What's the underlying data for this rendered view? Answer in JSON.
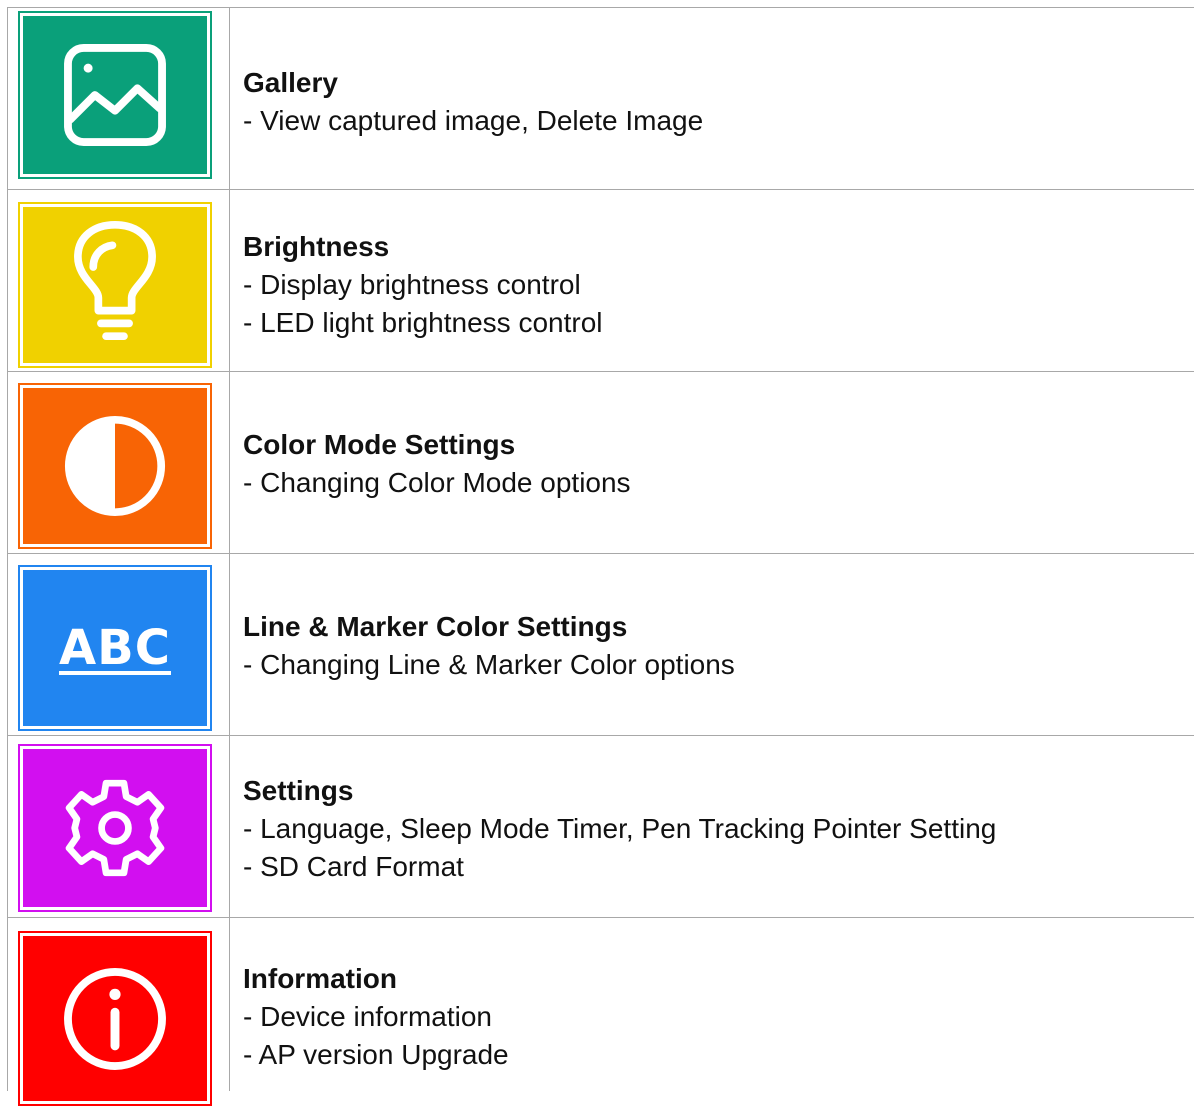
{
  "rows": [
    {
      "icon": "gallery-icon",
      "color": "#0aa07a",
      "title": "Gallery",
      "lines": [
        "- View captured image, Delete Image"
      ]
    },
    {
      "icon": "lightbulb-icon",
      "color": "#f0d100",
      "title": "Brightness",
      "lines": [
        "- Display brightness control",
        "- LED light brightness control"
      ]
    },
    {
      "icon": "half-circle-contrast-icon",
      "color": "#f86405",
      "title": "Color Mode Settings",
      "lines": [
        "- Changing Color Mode options"
      ]
    },
    {
      "icon": "abc-text-icon",
      "icon_text": "ABC",
      "color": "#2185f0",
      "title": "Line & Marker Color Settings",
      "lines": [
        "- Changing Line & Marker Color options"
      ]
    },
    {
      "icon": "gear-icon",
      "color": "#d20ff0",
      "title": "Settings",
      "lines": [
        "- Language, Sleep Mode Timer, Pen Tracking Pointer Setting",
        "- SD Card Format"
      ]
    },
    {
      "icon": "info-icon",
      "color": "#ff0000",
      "title": "Information",
      "lines": [
        "- Device information",
        "- AP version Upgrade"
      ]
    }
  ]
}
